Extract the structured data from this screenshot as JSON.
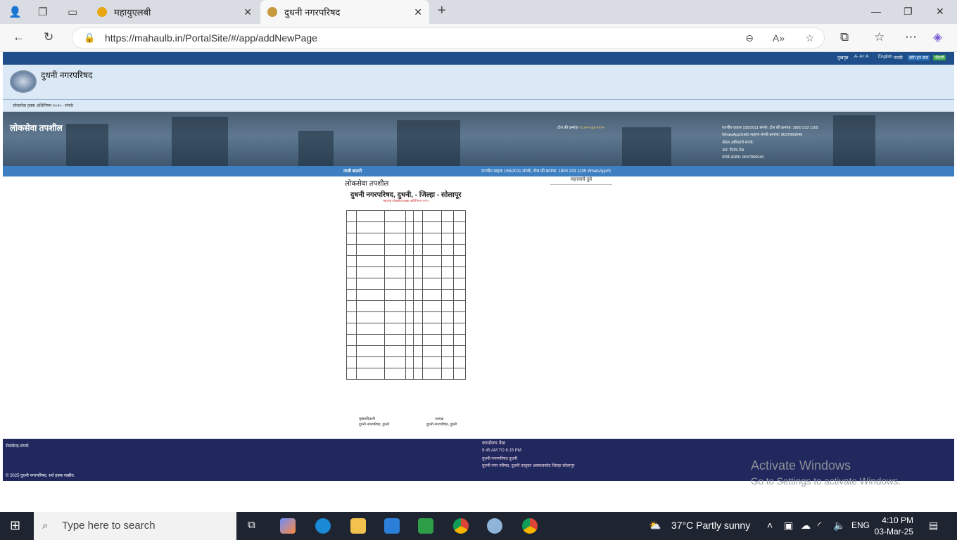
{
  "browser": {
    "tabs": [
      {
        "label": "महायुएलबी",
        "active": false
      },
      {
        "label": "दुधनी नगरपरिषद",
        "active": true
      }
    ],
    "url": "https://mahaulb.in/PortalSite/#/app/addNewPage"
  },
  "site": {
    "topstrip": {
      "home": "मुखपृष्ठ",
      "font_sizes": "A-  A+  A",
      "lang_en": "English",
      "lang_mr": "मराठी",
      "login": "लॉग इन करा",
      "signup": "नोंदणी"
    },
    "name": "दुधनी नगरपरिषद",
    "breadcrumb": [
      "लोकसेवा हक्क अधिनियम २०१५ -",
      "संपर्क"
    ],
    "banner": {
      "title": "लोकसेवा तपशील",
      "tollfree_label": "टोल फ्री क्रमांक",
      "tollfree_value": "१८००-२३३-११०५",
      "info": [
        "राज्यीय ग्राहक 155/2011 संपर्क, टोल फ्री क्रमांक: 1800 233 1105",
        "WhatsApp/SMS सहाय्य संपर्क क्रमांक: 9637860040",
        "नोडल अधिकारी संपर्क:",
        "नाव: विनोद सेल",
        "संपर्क क्रमांक: 9637860040"
      ]
    },
    "ticker": {
      "label": "ताजी बातमी",
      "text": "राज्यीय ग्राहक 155/2011 संपर्क, टोल फ्री क्रमांक: 1800 233 1105 WhatsApp/S"
    },
    "content": {
      "title": "लोकसेवा तपशील",
      "side_link": "महत्त्वाचे दुवे",
      "doc": {
        "heading": "दुधनी नगरपरिषद, दुधनी, - जिल्हा - सोलापूर",
        "subheading": "महाराष्ट्र लोकसेवा हक्क अधिनियम २०१५",
        "sig_left": "मुख्याधिकारी",
        "sig_left2": "दुधनी नगरपरिषद, दुधनी",
        "sig_right": "अध्यक्ष",
        "sig_right2": "दुधनी नगरपरिषद, दुधनी"
      }
    },
    "footer": {
      "left_top": "सेवाकेन्द्र-संपर्क",
      "copyright": "© 2025 दुधनी नगरपरिषद. सर्व हक्क राखीव.",
      "office_title": "कार्यालय वेळ",
      "office_time": "9.45 AM TO 6.15 PM",
      "office_name": "दुधनी नगरपरिषद दुधनी",
      "office_address": "दुधनी नगर परिषद, दुधनी तालुका अक्कलकोट जिल्हा सोलापूर"
    }
  },
  "watermark": {
    "line1": "Activate Windows",
    "line2": "Go to Settings to activate Windows."
  },
  "taskbar": {
    "search_placeholder": "Type here to search",
    "weather": "37°C  Partly sunny",
    "lang": "ENG",
    "time": "4:10 PM",
    "date": "03-Mar-25"
  }
}
